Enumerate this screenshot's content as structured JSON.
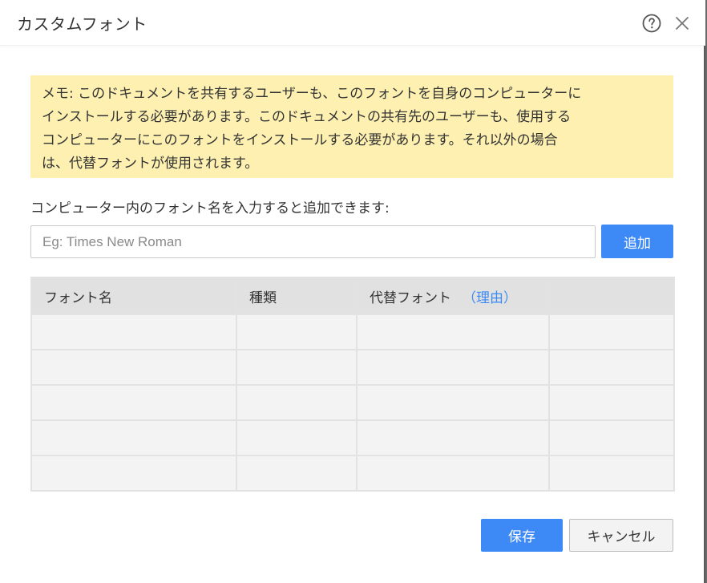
{
  "dialog": {
    "title": "カスタムフォント",
    "help_icon": "help-circle-icon",
    "close_icon": "close-icon"
  },
  "memo": {
    "lines": [
      "メモ: このドキュメントを共有するユーザーも、このフォントを自身のコンピューターに",
      "インストールする必要があります。このドキュメントの共有先のユーザーも、使用する",
      "コンピューターにこのフォントをインストールする必要があります。それ以外の場合",
      "は、代替フォントが使用されます。"
    ],
    "background": "#fdf0b1"
  },
  "instruction": "コンピューター内のフォント名を入力すると追加できます:",
  "input": {
    "placeholder": "Eg: Times New Roman",
    "value": ""
  },
  "add_button": "追加",
  "table": {
    "headers": [
      "フォント名",
      "種類",
      "代替フォント",
      ""
    ],
    "reason_link": "（理由）",
    "rows": [
      [
        "",
        "",
        "",
        ""
      ],
      [
        "",
        "",
        "",
        ""
      ],
      [
        "",
        "",
        "",
        ""
      ],
      [
        "",
        "",
        "",
        ""
      ],
      [
        "",
        "",
        "",
        ""
      ]
    ]
  },
  "footer": {
    "save_label": "保存",
    "cancel_label": "キャンセル"
  },
  "colors": {
    "accent": "#3d8af7",
    "header_bg": "#e1e1e1",
    "row_bg": "#f3f3f3"
  }
}
